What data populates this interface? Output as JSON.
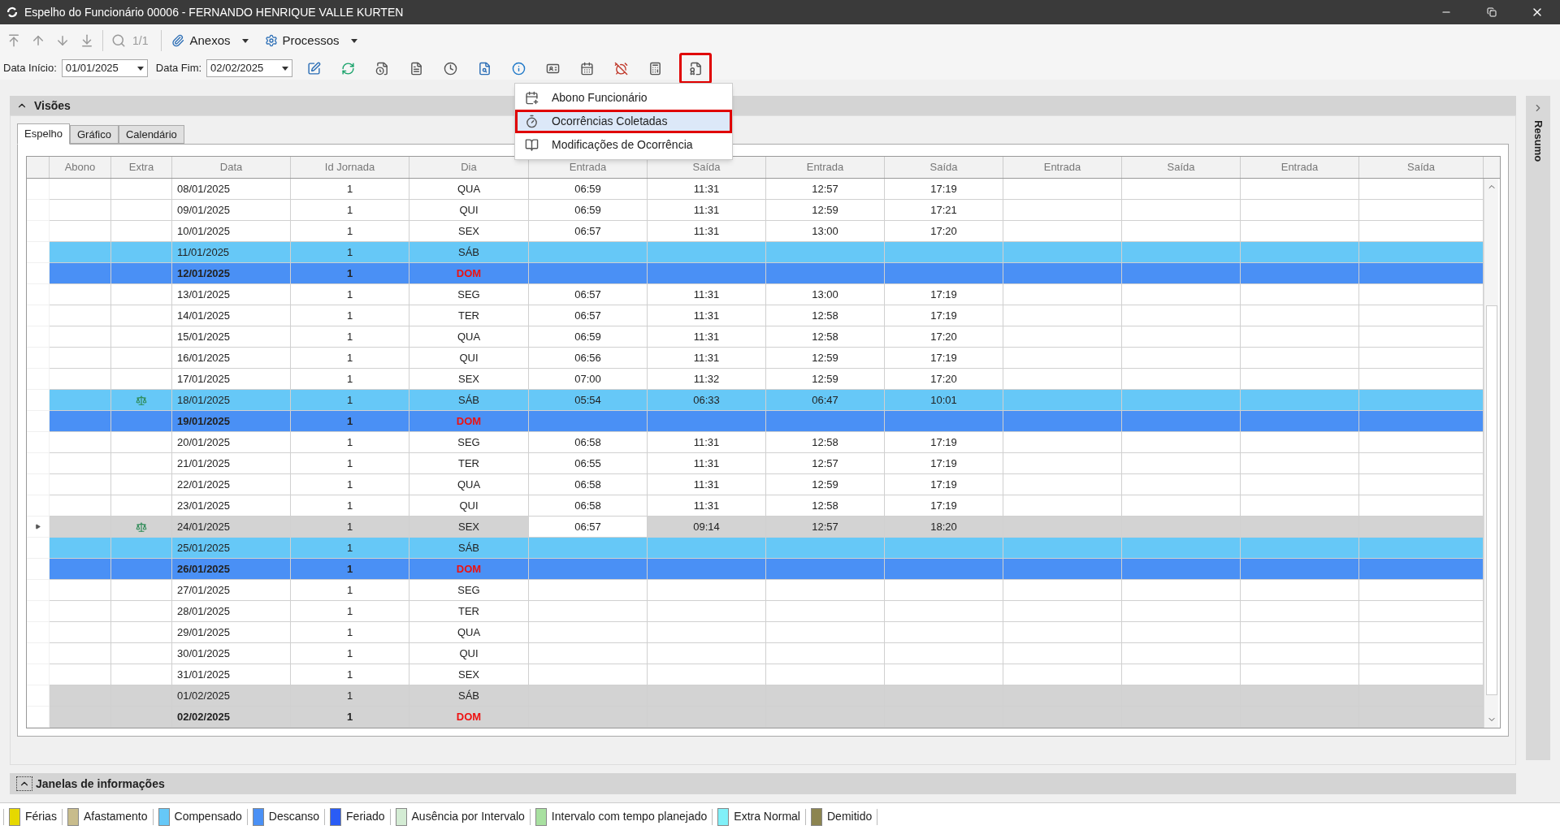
{
  "window": {
    "title": "Espelho do Funcionário 00006 - FERNANDO HENRIQUE VALLE KURTEN"
  },
  "toolbar": {
    "record_counter": "1/1",
    "anexos": "Anexos",
    "processos": "Processos"
  },
  "filters": {
    "start_label": "Data Início:",
    "start_value": "01/01/2025",
    "end_label": "Data Fim:",
    "end_value": "02/02/2025"
  },
  "menu_button": {
    "highlighted": true
  },
  "dropdown_menu": [
    {
      "label": "Abono Funcionário",
      "selected": false
    },
    {
      "label": "Ocorrências Coletadas",
      "selected": true
    },
    {
      "label": "Modificações de Ocorrência",
      "selected": false
    }
  ],
  "visoes": {
    "title": "Visões",
    "expanded": true
  },
  "tabs": [
    {
      "label": "Espelho",
      "selected": true
    },
    {
      "label": "Gráfico",
      "selected": false
    },
    {
      "label": "Calendário",
      "selected": false
    }
  ],
  "side_panel": {
    "title": "Resumo"
  },
  "table": {
    "columns": [
      "Abono",
      "Extra",
      "Data",
      "Id Jornada",
      "Dia",
      "Entrada",
      "Saída",
      "Entrada",
      "Saída",
      "Entrada",
      "Saída",
      "Entrada",
      "Saída"
    ],
    "rows": [
      {
        "data": "08/01/2025",
        "id_jornada": "1",
        "dia": "QUA",
        "times": [
          "06:59",
          "11:31",
          "12:57",
          "17:19"
        ],
        "kind": "normal",
        "extra_icon": false,
        "current": false
      },
      {
        "data": "09/01/2025",
        "id_jornada": "1",
        "dia": "QUI",
        "times": [
          "06:59",
          "11:31",
          "12:59",
          "17:21"
        ],
        "kind": "normal",
        "extra_icon": false,
        "current": false
      },
      {
        "data": "10/01/2025",
        "id_jornada": "1",
        "dia": "SEX",
        "times": [
          "06:57",
          "11:31",
          "13:00",
          "17:20"
        ],
        "kind": "normal",
        "extra_icon": false,
        "current": false
      },
      {
        "data": "11/01/2025",
        "id_jornada": "1",
        "dia": "SÁB",
        "times": [],
        "kind": "compensado",
        "extra_icon": false,
        "current": false
      },
      {
        "data": "12/01/2025",
        "id_jornada": "1",
        "dia": "DOM",
        "times": [],
        "kind": "descanso",
        "extra_icon": false,
        "current": false
      },
      {
        "data": "13/01/2025",
        "id_jornada": "1",
        "dia": "SEG",
        "times": [
          "06:57",
          "11:31",
          "13:00",
          "17:19"
        ],
        "kind": "normal",
        "extra_icon": false,
        "current": false
      },
      {
        "data": "14/01/2025",
        "id_jornada": "1",
        "dia": "TER",
        "times": [
          "06:57",
          "11:31",
          "12:58",
          "17:19"
        ],
        "kind": "normal",
        "extra_icon": false,
        "current": false
      },
      {
        "data": "15/01/2025",
        "id_jornada": "1",
        "dia": "QUA",
        "times": [
          "06:59",
          "11:31",
          "12:58",
          "17:20"
        ],
        "kind": "normal",
        "extra_icon": false,
        "current": false
      },
      {
        "data": "16/01/2025",
        "id_jornada": "1",
        "dia": "QUI",
        "times": [
          "06:56",
          "11:31",
          "12:59",
          "17:19"
        ],
        "kind": "normal",
        "extra_icon": false,
        "current": false
      },
      {
        "data": "17/01/2025",
        "id_jornada": "1",
        "dia": "SEX",
        "times": [
          "07:00",
          "11:32",
          "12:59",
          "17:20"
        ],
        "kind": "normal",
        "extra_icon": false,
        "current": false
      },
      {
        "data": "18/01/2025",
        "id_jornada": "1",
        "dia": "SÁB",
        "times": [
          "05:54",
          "06:33",
          "06:47",
          "10:01"
        ],
        "kind": "compensado",
        "extra_icon": true,
        "current": false
      },
      {
        "data": "19/01/2025",
        "id_jornada": "1",
        "dia": "DOM",
        "times": [],
        "kind": "descanso",
        "extra_icon": false,
        "current": false
      },
      {
        "data": "20/01/2025",
        "id_jornada": "1",
        "dia": "SEG",
        "times": [
          "06:58",
          "11:31",
          "12:58",
          "17:19"
        ],
        "kind": "normal",
        "extra_icon": false,
        "current": false
      },
      {
        "data": "21/01/2025",
        "id_jornada": "1",
        "dia": "TER",
        "times": [
          "06:55",
          "11:31",
          "12:57",
          "17:19"
        ],
        "kind": "normal",
        "extra_icon": false,
        "current": false
      },
      {
        "data": "22/01/2025",
        "id_jornada": "1",
        "dia": "QUA",
        "times": [
          "06:58",
          "11:31",
          "12:59",
          "17:19"
        ],
        "kind": "normal",
        "extra_icon": false,
        "current": false
      },
      {
        "data": "23/01/2025",
        "id_jornada": "1",
        "dia": "QUI",
        "times": [
          "06:58",
          "11:31",
          "12:58",
          "17:19"
        ],
        "kind": "normal",
        "extra_icon": false,
        "current": false
      },
      {
        "data": "24/01/2025",
        "id_jornada": "1",
        "dia": "SEX",
        "times": [
          "06:57",
          "09:14",
          "12:57",
          "18:20"
        ],
        "kind": "future",
        "extra_icon": true,
        "current": true
      },
      {
        "data": "25/01/2025",
        "id_jornada": "1",
        "dia": "SÁB",
        "times": [],
        "kind": "compensado",
        "extra_icon": false,
        "current": false
      },
      {
        "data": "26/01/2025",
        "id_jornada": "1",
        "dia": "DOM",
        "times": [],
        "kind": "descanso",
        "extra_icon": false,
        "current": false
      },
      {
        "data": "27/01/2025",
        "id_jornada": "1",
        "dia": "SEG",
        "times": [],
        "kind": "normal",
        "extra_icon": false,
        "current": false
      },
      {
        "data": "28/01/2025",
        "id_jornada": "1",
        "dia": "TER",
        "times": [],
        "kind": "normal",
        "extra_icon": false,
        "current": false
      },
      {
        "data": "29/01/2025",
        "id_jornada": "1",
        "dia": "QUA",
        "times": [],
        "kind": "normal",
        "extra_icon": false,
        "current": false
      },
      {
        "data": "30/01/2025",
        "id_jornada": "1",
        "dia": "QUI",
        "times": [],
        "kind": "normal",
        "extra_icon": false,
        "current": false
      },
      {
        "data": "31/01/2025",
        "id_jornada": "1",
        "dia": "SEX",
        "times": [],
        "kind": "normal",
        "extra_icon": false,
        "current": false
      },
      {
        "data": "01/02/2025",
        "id_jornada": "1",
        "dia": "SÁB",
        "times": [],
        "kind": "future",
        "extra_icon": false,
        "current": false
      },
      {
        "data": "02/02/2025",
        "id_jornada": "1",
        "dia": "DOM",
        "times": [],
        "kind": "future_sunday",
        "extra_icon": false,
        "current": false
      }
    ]
  },
  "info_panel": {
    "title": "Janelas de informações",
    "expanded": false
  },
  "legend": [
    {
      "label": "Férias",
      "color": "#e6d800"
    },
    {
      "label": "Afastamento",
      "color": "#c8bc8c"
    },
    {
      "label": "Compensado",
      "color": "#66c8f7"
    },
    {
      "label": "Descanso",
      "color": "#4a90f5"
    },
    {
      "label": "Feriado",
      "color": "#2a5cf5"
    },
    {
      "label": "Ausência por Intervalo",
      "color": "#d4ecd4"
    },
    {
      "label": "Intervalo com tempo planejado",
      "color": "#a8e0a0"
    },
    {
      "label": "Extra Normal",
      "color": "#80f0f8"
    },
    {
      "label": "Demitido",
      "color": "#8c8450"
    }
  ]
}
